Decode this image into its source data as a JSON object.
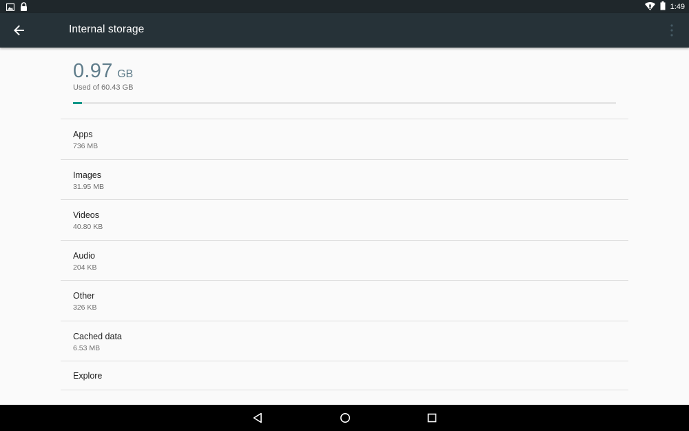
{
  "status_bar": {
    "time": "1:49",
    "left_icons": [
      "image-icon",
      "lock-icon"
    ],
    "right_icons": [
      "wifi-icon",
      "battery-icon"
    ]
  },
  "toolbar": {
    "title": "Internal storage",
    "back_icon": "arrow-back-icon"
  },
  "summary": {
    "used_value": "0.97",
    "used_unit": "GB",
    "used_of": "Used of 60.43 GB",
    "progress_fraction": 0.016,
    "accent_color": "#009688",
    "value_color": "#607d8b"
  },
  "items": [
    {
      "title": "Apps",
      "subtitle": "736 MB"
    },
    {
      "title": "Images",
      "subtitle": "31.95 MB"
    },
    {
      "title": "Videos",
      "subtitle": "40.80 KB"
    },
    {
      "title": "Audio",
      "subtitle": "204 KB"
    },
    {
      "title": "Other",
      "subtitle": "326 KB"
    },
    {
      "title": "Cached data",
      "subtitle": "6.53 MB"
    },
    {
      "title": "Explore"
    }
  ],
  "nav_bar": {
    "icons": [
      "back-triangle-icon",
      "home-circle-icon",
      "recents-square-icon"
    ]
  },
  "colors": {
    "toolbar": "#263238",
    "status_bar": "#1f272b",
    "background": "#fafafa"
  }
}
